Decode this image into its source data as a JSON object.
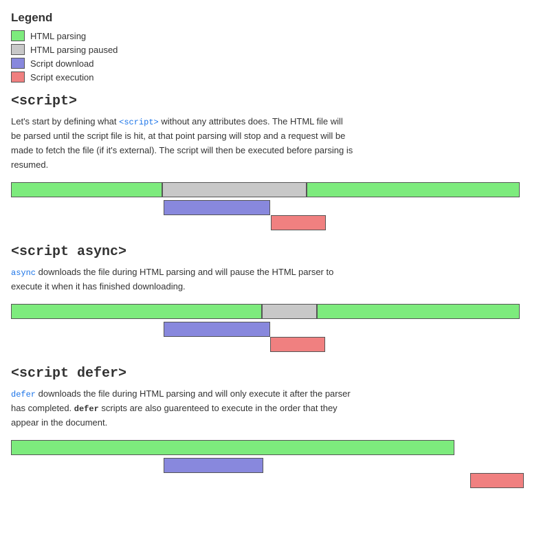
{
  "legend": {
    "title": "Legend",
    "items": [
      {
        "label": "HTML parsing",
        "color": "#7deb7d"
      },
      {
        "label": "HTML parsing paused",
        "color": "#c8c8c8"
      },
      {
        "label": "Script download",
        "color": "#8888dd"
      },
      {
        "label": "Script execution",
        "color": "#f08080"
      }
    ]
  },
  "sections": [
    {
      "id": "script",
      "heading": "<script>",
      "description_html": "Let's start by defining what <code class='highlight'>&lt;script&gt;</code> without any attributes does. The HTML file will be parsed until the script file is hit, at that point parsing will stop and a request will be made to fetch the file (if it's external). The script will then be executed before parsing is resumed."
    },
    {
      "id": "script-async",
      "heading": "<script async>",
      "description_html": "<code class='highlight'>async</code> downloads the file during HTML parsing and will pause the HTML parser to execute it when it has finished downloading."
    },
    {
      "id": "script-defer",
      "heading": "<script defer>",
      "description_html": "<code class='highlight'>defer</code> downloads the file during HTML parsing and will only execute it after the parser has completed. <strong>defer</strong> scripts are also guarenteed to execute in the order that they appear in the document."
    }
  ]
}
